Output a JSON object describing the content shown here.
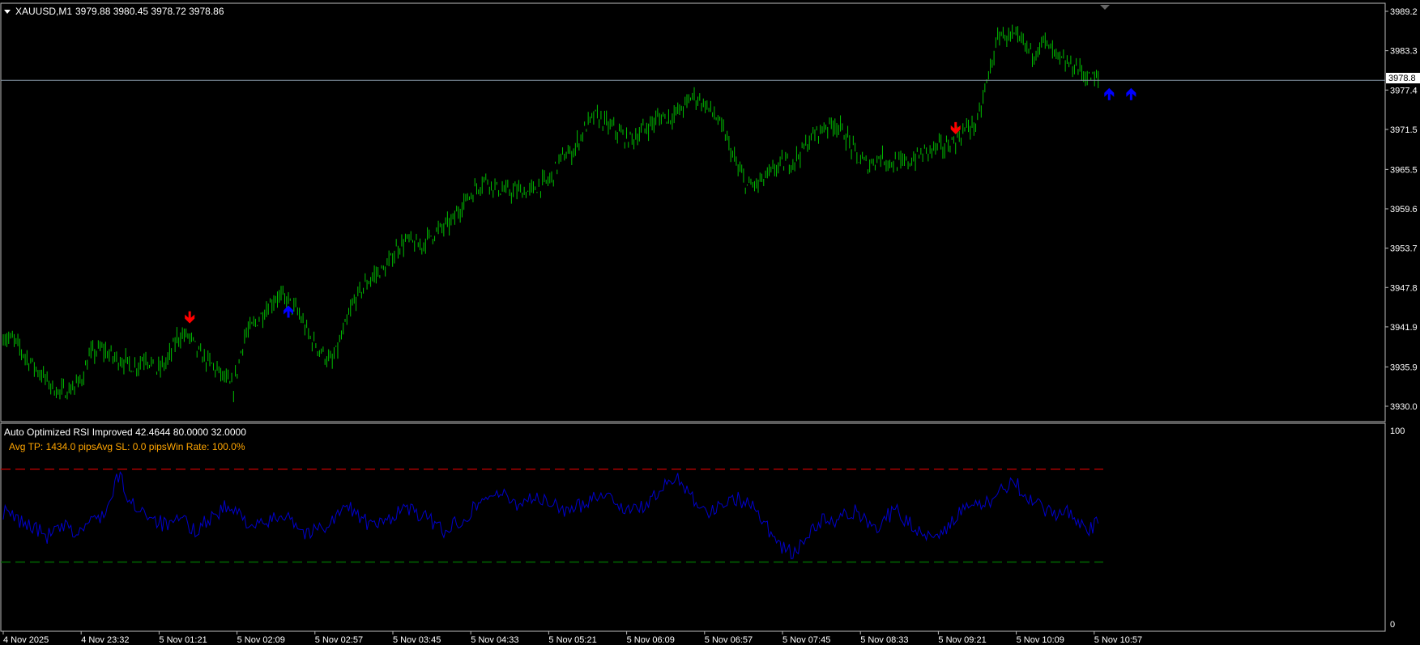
{
  "main_chart": {
    "header": {
      "symbol_label": "XAUUSD,M1",
      "ohlc_label": "3979.88 3980.45 3978.72 3978.86"
    },
    "price_axis": {
      "ticks": [
        "3989.2",
        "3983.3",
        "3977.4",
        "3971.5",
        "3965.5",
        "3959.6",
        "3953.7",
        "3947.8",
        "3941.9",
        "3935.9",
        "3930.0"
      ],
      "current_price": "3978.8"
    },
    "colors": {
      "candles": "#00c000",
      "sell_arrow": "#ff0000",
      "buy_arrow": "#0000ff",
      "bid_line": "#8899aa"
    },
    "signals": [
      {
        "type": "sell",
        "time_index": 17,
        "label": "sell-arrow"
      },
      {
        "type": "buy",
        "time_index": 26,
        "label": "buy-arrow"
      },
      {
        "type": "sell",
        "time_index": 87,
        "label": "sell-arrow"
      },
      {
        "type": "buy",
        "time_index": 101,
        "label": "buy-arrow"
      },
      {
        "type": "buy",
        "time_index": 103,
        "label": "buy-arrow"
      },
      {
        "type": "sell",
        "time_index": 130,
        "label": "sell-arrow"
      }
    ]
  },
  "indicator": {
    "title": "Auto Optimized RSI Improved 42.4644 80.0000 32.0000",
    "stats": "Avg TP: 1434.0 pipsAvg SL: 0.0 pipsWin Rate: 100.0%",
    "axis_top": "100",
    "axis_bottom": "0",
    "overbought": 80,
    "oversold": 32,
    "colors": {
      "line": "#0000cc",
      "overbought": "#aa0000",
      "oversold": "#006600"
    }
  },
  "time_axis": {
    "labels": [
      "4 Nov 2025",
      "4 Nov 23:32",
      "5 Nov 01:21",
      "5 Nov 02:09",
      "5 Nov 02:57",
      "5 Nov 03:45",
      "5 Nov 04:33",
      "5 Nov 05:21",
      "5 Nov 06:09",
      "5 Nov 06:57",
      "5 Nov 07:45",
      "5 Nov 08:33",
      "5 Nov 09:21",
      "5 Nov 10:09",
      "5 Nov 10:57"
    ]
  },
  "chart_data": [
    {
      "type": "line",
      "title": "XAUUSD,M1",
      "ylim": [
        3930.0,
        3989.2
      ],
      "x": [
        "4 Nov 2025",
        "4 Nov 23:32",
        "5 Nov 01:21",
        "5 Nov 02:09",
        "5 Nov 02:57",
        "5 Nov 03:45",
        "5 Nov 04:33",
        "5 Nov 05:21",
        "5 Nov 06:09",
        "5 Nov 06:57",
        "5 Nov 07:45",
        "5 Nov 08:33",
        "5 Nov 09:21",
        "5 Nov 10:09",
        "5 Nov 10:57"
      ],
      "series": [
        {
          "values": [
            3940.5,
            3939.8,
            3937.6,
            3935.7,
            3933.8,
            3932.1,
            3932.4,
            3933.6,
            3937.8,
            3938.6,
            3937.4,
            3936.8,
            3935.8,
            3937.6,
            3935.2,
            3936.8,
            3940.6,
            3940.5,
            3937.6,
            3936.3,
            3934.6,
            3932.5,
            3940.4,
            3942.4,
            3944.6,
            3946.5,
            3945.9,
            3943.8,
            3940.3,
            3938.3,
            3936.4,
            3940.7,
            3945.6,
            3948.1,
            3949.8,
            3950.7,
            3953.9,
            3954.9,
            3953.8,
            3955.6,
            3956.6,
            3957.7,
            3960.5,
            3962.3,
            3964.2,
            3962.7,
            3962.1,
            3962.3,
            3962.1,
            3963.1,
            3964.0,
            3967.4,
            3968.0,
            3971.3,
            3973.6,
            3972.4,
            3971.3,
            3969.9,
            3970.7,
            3972.1,
            3973.4,
            3973.4,
            3974.6,
            3976.6,
            3975.4,
            3973.6,
            3970.4,
            3965.9,
            3962.9,
            3963.4,
            3964.8,
            3966.3,
            3966.6,
            3968.4,
            3970.6,
            3971.9,
            3972.5,
            3970.4,
            3967.3,
            3966.1,
            3967.4,
            3966.7,
            3966.2,
            3966.9,
            3967.9,
            3968.7,
            3968.9,
            3969.9,
            3971.7,
            3972.5,
            3979.8,
            3985.9,
            3985.3,
            3984.6,
            3982.9,
            3984.8,
            3982.7,
            3981.3,
            3980.9,
            3979.4,
            3978.9
          ],
          "note_dummy": ""
        }
      ]
    },
    {
      "type": "line",
      "title": "Auto Optimized RSI Improved 42.4644 80.0000 32.0000",
      "ylim": [
        0,
        100
      ],
      "series": [
        {
          "values": [
            58,
            55,
            52,
            50,
            45,
            48,
            50,
            46,
            52,
            55,
            60,
            78,
            62,
            60,
            56,
            52,
            50,
            55,
            48,
            52,
            56,
            60,
            58,
            54,
            50,
            52,
            55,
            58,
            50,
            46,
            50,
            52,
            58,
            60,
            55,
            50,
            52,
            56,
            60,
            58,
            55,
            52,
            48,
            52,
            56,
            62,
            66,
            68,
            64,
            62,
            66,
            64,
            62,
            60,
            58,
            62,
            66,
            68,
            64,
            60,
            58,
            62,
            66,
            72,
            76,
            70,
            62,
            58,
            60,
            66,
            64,
            62,
            56,
            46,
            40,
            36,
            42,
            50,
            54,
            52,
            56,
            58,
            54,
            50,
            56,
            58,
            52,
            48,
            46,
            48,
            52,
            58,
            60,
            62,
            64,
            70,
            76,
            64,
            62,
            58,
            56,
            60,
            54,
            48,
            52
          ]
        }
      ]
    }
  ]
}
